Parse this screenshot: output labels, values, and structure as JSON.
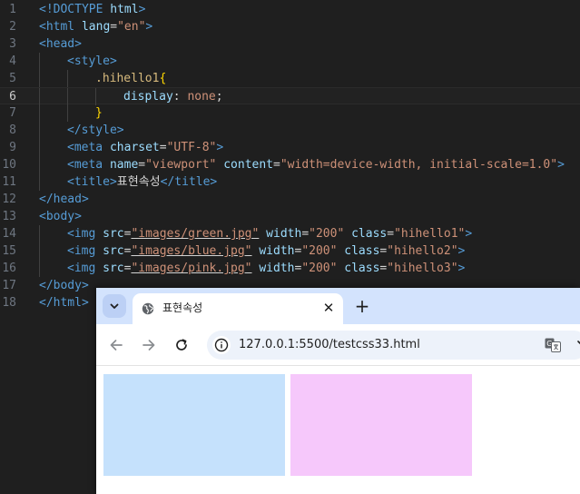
{
  "editor": {
    "lines": [
      {
        "n": "1",
        "indent": 0,
        "tokens": [
          [
            "tag",
            "<!DOCTYPE "
          ],
          [
            "attr",
            "html"
          ],
          [
            "tag",
            ">"
          ]
        ]
      },
      {
        "n": "2",
        "indent": 0,
        "tokens": [
          [
            "tag",
            "<html "
          ],
          [
            "attr",
            "lang"
          ],
          [
            "text",
            "="
          ],
          [
            "str",
            "\"en\""
          ],
          [
            "tag",
            ">"
          ]
        ]
      },
      {
        "n": "3",
        "indent": 0,
        "tokens": [
          [
            "tag",
            "<head>"
          ]
        ]
      },
      {
        "n": "4",
        "indent": 1,
        "tokens": [
          [
            "tag",
            "<style>"
          ]
        ]
      },
      {
        "n": "5",
        "indent": 2,
        "tokens": [
          [
            "sel",
            ".hihello1"
          ],
          [
            "brace",
            "{"
          ]
        ]
      },
      {
        "n": "6",
        "indent": 3,
        "tokens": [
          [
            "attr",
            "display"
          ],
          [
            "text",
            ": "
          ],
          [
            "val",
            "none"
          ],
          [
            "text",
            ";"
          ]
        ]
      },
      {
        "n": "7",
        "indent": 2,
        "tokens": [
          [
            "brace",
            "}"
          ]
        ]
      },
      {
        "n": "8",
        "indent": 1,
        "tokens": [
          [
            "tag",
            "</style>"
          ]
        ]
      },
      {
        "n": "9",
        "indent": 1,
        "tokens": [
          [
            "tag",
            "<meta "
          ],
          [
            "attr",
            "charset"
          ],
          [
            "text",
            "="
          ],
          [
            "str",
            "\"UTF-8\""
          ],
          [
            "tag",
            ">"
          ]
        ]
      },
      {
        "n": "10",
        "indent": 1,
        "tokens": [
          [
            "tag",
            "<meta "
          ],
          [
            "attr",
            "name"
          ],
          [
            "text",
            "="
          ],
          [
            "str",
            "\"viewport\""
          ],
          [
            "text",
            " "
          ],
          [
            "attr",
            "content"
          ],
          [
            "text",
            "="
          ],
          [
            "str",
            "\"width=device-width, initial-scale=1.0\""
          ],
          [
            "tag",
            ">"
          ]
        ]
      },
      {
        "n": "11",
        "indent": 1,
        "tokens": [
          [
            "tag",
            "<title>"
          ],
          [
            "text",
            "표현속성"
          ],
          [
            "tag",
            "</title>"
          ]
        ]
      },
      {
        "n": "12",
        "indent": 0,
        "tokens": [
          [
            "tag",
            "</head>"
          ]
        ]
      },
      {
        "n": "13",
        "indent": 0,
        "tokens": [
          [
            "tag",
            "<body>"
          ]
        ]
      },
      {
        "n": "14",
        "indent": 1,
        "tokens": [
          [
            "tag",
            "<img "
          ],
          [
            "attr",
            "src"
          ],
          [
            "text",
            "="
          ],
          [
            "link",
            "\"images/green.jpg\""
          ],
          [
            "text",
            " "
          ],
          [
            "attr",
            "width"
          ],
          [
            "text",
            "="
          ],
          [
            "str",
            "\"200\""
          ],
          [
            "text",
            " "
          ],
          [
            "attr",
            "class"
          ],
          [
            "text",
            "="
          ],
          [
            "str",
            "\"hihello1\""
          ],
          [
            "tag",
            ">"
          ]
        ]
      },
      {
        "n": "15",
        "indent": 1,
        "tokens": [
          [
            "tag",
            "<img "
          ],
          [
            "attr",
            "src"
          ],
          [
            "text",
            "="
          ],
          [
            "link",
            "\"images/blue.jpg\""
          ],
          [
            "text",
            " "
          ],
          [
            "attr",
            "width"
          ],
          [
            "text",
            "="
          ],
          [
            "str",
            "\"200\""
          ],
          [
            "text",
            " "
          ],
          [
            "attr",
            "class"
          ],
          [
            "text",
            "="
          ],
          [
            "str",
            "\"hihello2\""
          ],
          [
            "tag",
            ">"
          ]
        ]
      },
      {
        "n": "16",
        "indent": 1,
        "tokens": [
          [
            "tag",
            "<img "
          ],
          [
            "attr",
            "src"
          ],
          [
            "text",
            "="
          ],
          [
            "link",
            "\"images/pink.jpg\""
          ],
          [
            "text",
            " "
          ],
          [
            "attr",
            "width"
          ],
          [
            "text",
            "="
          ],
          [
            "str",
            "\"200\""
          ],
          [
            "text",
            " "
          ],
          [
            "attr",
            "class"
          ],
          [
            "text",
            "="
          ],
          [
            "str",
            "\"hihello3\""
          ],
          [
            "tag",
            ">"
          ]
        ]
      },
      {
        "n": "17",
        "indent": 0,
        "tokens": [
          [
            "tag",
            "</body>"
          ]
        ]
      },
      {
        "n": "18",
        "indent": 0,
        "tokens": [
          [
            "tag",
            "</html>"
          ]
        ]
      }
    ],
    "active_line": "6"
  },
  "browser": {
    "tab_title": "표현속성",
    "close_glyph": "✕",
    "new_tab_glyph": "+",
    "url": "127.0.0.1:5500/testcss33.html",
    "images": [
      {
        "name": "blue-image",
        "color": "#c5e1fc"
      },
      {
        "name": "pink-image",
        "color": "#f6c8fb"
      }
    ]
  },
  "colors": {
    "tabstrip": "#d3e3fd",
    "omnibox": "#edf2fa",
    "editor_bg": "#1f1f1f"
  }
}
